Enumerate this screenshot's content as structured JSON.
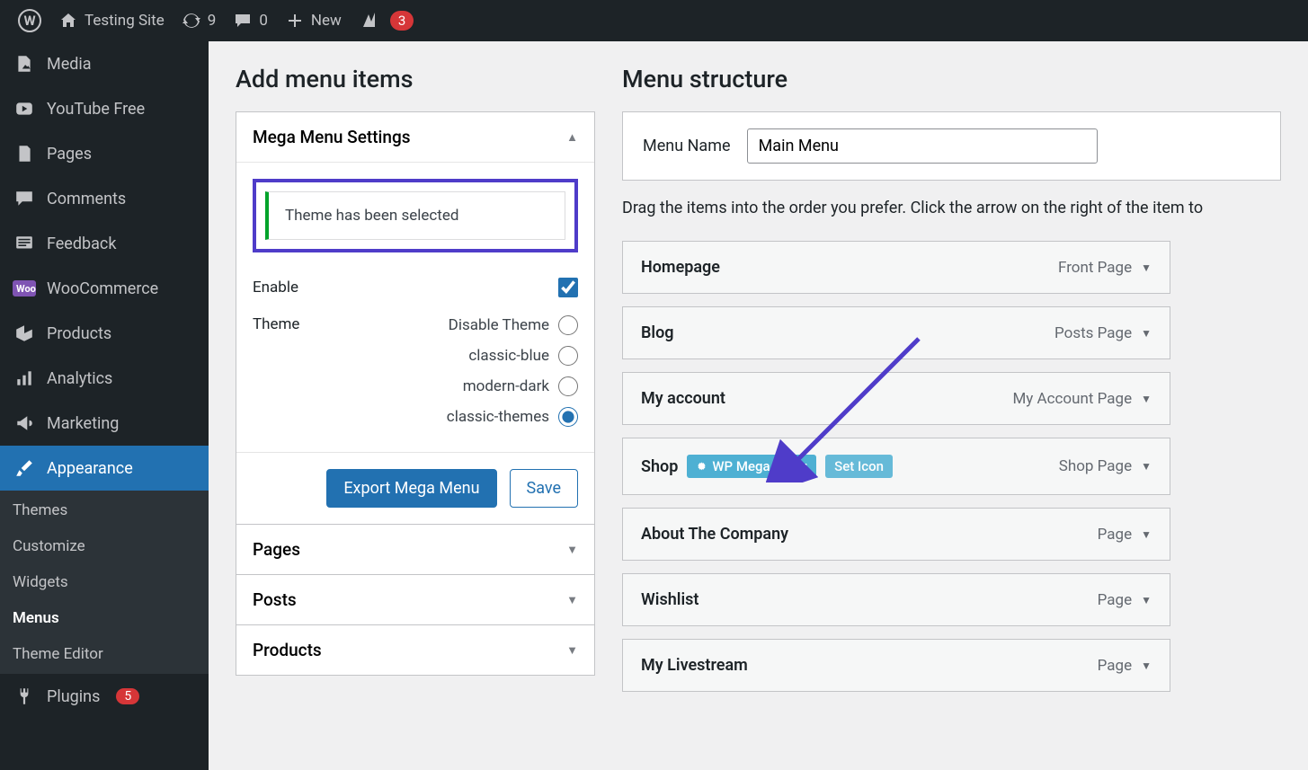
{
  "topbar": {
    "site_name": "Testing Site",
    "updates_count": "9",
    "comments_count": "0",
    "new_label": "New",
    "yoast_count": "3"
  },
  "sidebar": {
    "items": [
      {
        "label": "Media",
        "icon": "media"
      },
      {
        "label": "YouTube Free",
        "icon": "youtube"
      },
      {
        "label": "Pages",
        "icon": "pages"
      },
      {
        "label": "Comments",
        "icon": "comments"
      },
      {
        "label": "Feedback",
        "icon": "feedback"
      },
      {
        "label": "WooCommerce",
        "icon": "woo"
      },
      {
        "label": "Products",
        "icon": "products"
      },
      {
        "label": "Analytics",
        "icon": "analytics"
      },
      {
        "label": "Marketing",
        "icon": "marketing"
      },
      {
        "label": "Appearance",
        "icon": "brush",
        "active": true
      },
      {
        "label": "Plugins",
        "icon": "plug",
        "badge": "5"
      }
    ],
    "submenu": [
      {
        "label": "Themes"
      },
      {
        "label": "Customize"
      },
      {
        "label": "Widgets"
      },
      {
        "label": "Menus",
        "active": true
      },
      {
        "label": "Theme Editor"
      }
    ]
  },
  "add_items": {
    "heading": "Add menu items",
    "mega": {
      "title": "Mega Menu Settings",
      "notice": "Theme has been selected",
      "enable_label": "Enable",
      "enable_checked": true,
      "theme_label": "Theme",
      "theme_options": [
        {
          "label": "Disable Theme",
          "value": "disable"
        },
        {
          "label": "classic-blue",
          "value": "classic-blue"
        },
        {
          "label": "modern-dark",
          "value": "modern-dark"
        },
        {
          "label": "classic-themes",
          "value": "classic-themes"
        }
      ],
      "theme_selected": "classic-themes",
      "export_label": "Export Mega Menu",
      "save_label": "Save"
    },
    "accordions": [
      "Pages",
      "Posts",
      "Products"
    ]
  },
  "structure": {
    "heading": "Menu structure",
    "name_label": "Menu Name",
    "name_value": "Main Menu",
    "instructions": "Drag the items into the order you prefer. Click the arrow on the right of the item to",
    "wp_mega_label": "WP Mega Menu",
    "set_icon_label": "Set Icon",
    "items": [
      {
        "title": "Homepage",
        "type": "Front Page"
      },
      {
        "title": "Blog",
        "type": "Posts Page"
      },
      {
        "title": "My account",
        "type": "My Account Page"
      },
      {
        "title": "Shop",
        "type": "Shop Page",
        "hover": true
      },
      {
        "title": "About The Company",
        "type": "Page"
      },
      {
        "title": "Wishlist",
        "type": "Page"
      },
      {
        "title": "My Livestream",
        "type": "Page"
      }
    ]
  }
}
